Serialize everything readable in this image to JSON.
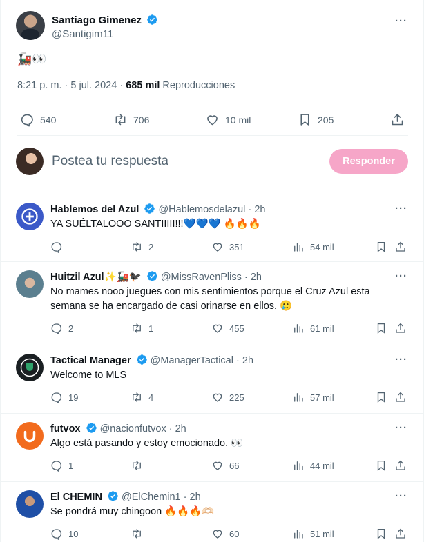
{
  "tweet": {
    "author_name": "Santiago Gimenez",
    "author_handle": "@Santigim11",
    "text": "🚂👀",
    "time": "8:21 p. m.",
    "date": "5 jul. 2024",
    "views": "685 mil",
    "views_label": "Reproducciones",
    "replies": "540",
    "retweets": "706",
    "likes": "10 mil",
    "bookmarks": "205",
    "more": "···"
  },
  "compose": {
    "placeholder": "Postea tu respuesta",
    "button": "Responder"
  },
  "colors": {
    "accent_pink": "#f6a6c8",
    "verified_blue": "#1d9bf0",
    "muted": "#536471"
  },
  "replies": [
    {
      "name": "Hablemos del Azul",
      "handle": "@Hablemosdelazul",
      "time": "2h",
      "text": "YA SUÉLTALOOO SANTIIIII!!!💙💙💙 🔥🔥🔥",
      "replies": "",
      "retweets": "2",
      "likes": "351",
      "views": "54 mil"
    },
    {
      "name": "Huitzil Azul✨🚂🐦‍⬛",
      "handle": "@MissRavenPliss",
      "time": "2h",
      "text": "No mames nooo juegues con mis sentimientos porque el Cruz Azul esta semana se ha encargado de casi orinarse en ellos. 🥲",
      "replies": "2",
      "retweets": "1",
      "likes": "455",
      "views": "61 mil"
    },
    {
      "name": "Tactical Manager",
      "handle": "@ManagerTactical",
      "time": "2h",
      "text": "Welcome to MLS",
      "replies": "19",
      "retweets": "4",
      "likes": "225",
      "views": "57 mil"
    },
    {
      "name": "futvox",
      "handle": "@nacionfutvox",
      "time": "2h",
      "text": "Algo está pasando y estoy emocionado. 👀",
      "replies": "1",
      "retweets": "",
      "likes": "66",
      "views": "44 mil"
    },
    {
      "name": "El CHEMIN",
      "handle": "@ElChemin1",
      "time": "2h",
      "text": "Se pondrá muy chingoon  🔥🔥🔥🫶🏻",
      "replies": "10",
      "retweets": "",
      "likes": "60",
      "views": "51 mil"
    }
  ],
  "separator": "·"
}
